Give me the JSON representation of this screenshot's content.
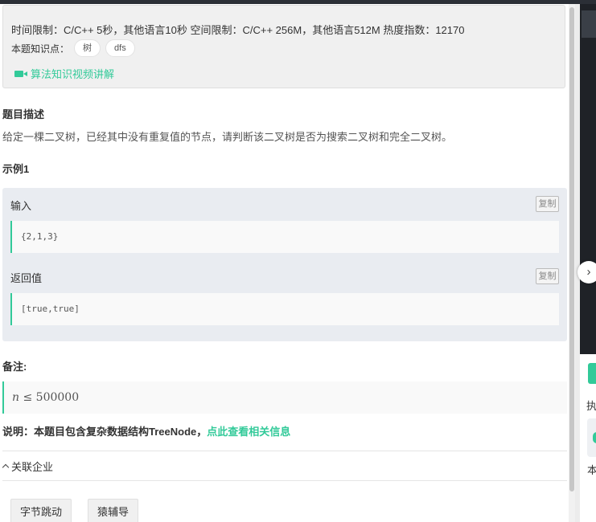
{
  "problem": {
    "limits_text": "时间限制：C/C++ 5秒，其他语言10秒    空间限制：C/C++ 256M，其他语言512M    热度指数：12170",
    "knowledge_label": "本题知识点：",
    "tags": [
      "树",
      "dfs"
    ],
    "video_link": "算法知识视频讲解",
    "description_title": "题目描述",
    "description": "给定一棵二叉树，已经其中没有重复值的节点，请判断该二叉树是否为搜索二叉树和完全二叉树。"
  },
  "example": {
    "title": "示例1",
    "input_label": "输入",
    "input_value": "{2,1,3}",
    "output_label": "返回值",
    "output_value": "[true,true]",
    "copy_label": "复制"
  },
  "note": {
    "title": "备注:",
    "var": "n",
    "op": "≤",
    "value": "500000"
  },
  "explain": {
    "text": "说明：本题目包含复杂数据结构TreeNode，",
    "link": "点此查看相关信息"
  },
  "companies": {
    "toggle_label": "关联企业",
    "items": [
      "字节跳动",
      "猿辅导"
    ]
  },
  "right_panel": {
    "collapse_icon": "chevron-right-icon",
    "partial_text_1": "执",
    "partial_text_2": "本"
  },
  "colors": {
    "accent": "#32ca99"
  }
}
